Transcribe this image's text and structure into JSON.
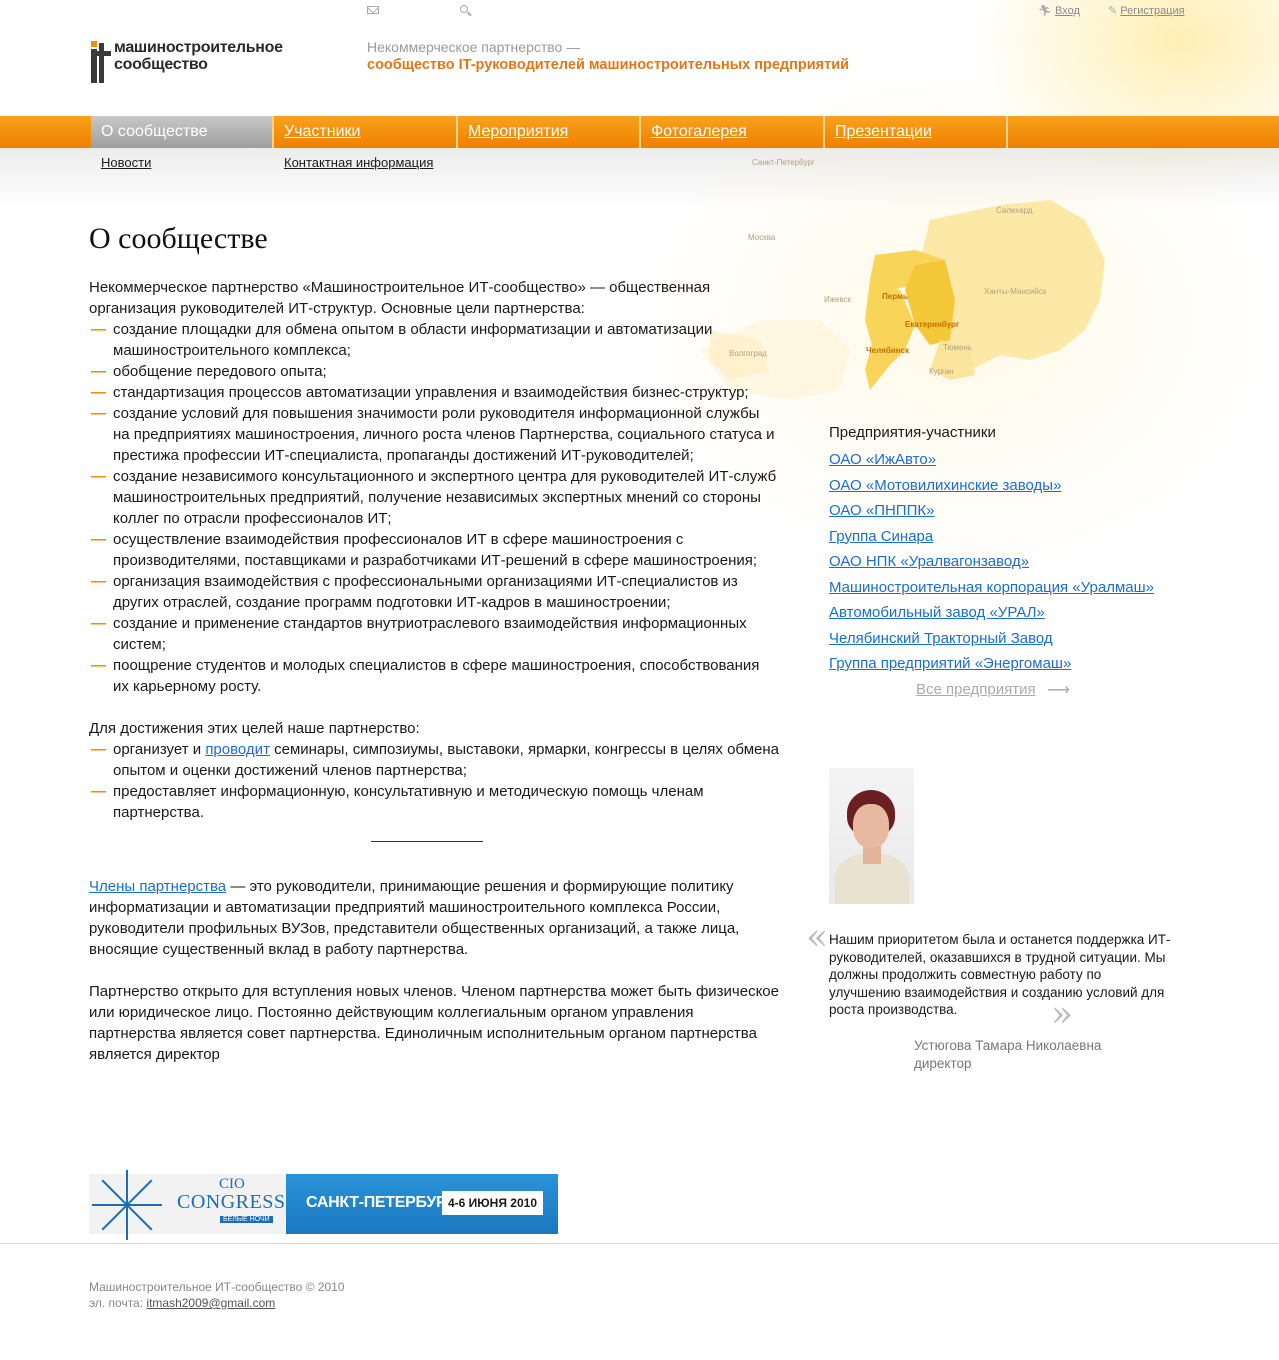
{
  "top": {
    "login_label": "Вход",
    "register_label": "Регистрация"
  },
  "logo": {
    "line1": "машиностроительное",
    "line2": "сообщество"
  },
  "tagline": {
    "line1": "Некоммерческое партнерство —",
    "line2": "сообщество IT-руководителей машиностроительных предприятий"
  },
  "nav": {
    "items": [
      {
        "label": "О сообществе",
        "active": true
      },
      {
        "label": "Участники"
      },
      {
        "label": "Мероприятия"
      },
      {
        "label": "Фотогалерея"
      },
      {
        "label": "Презентации"
      }
    ],
    "sub": [
      "Новости",
      "Контактная информация"
    ]
  },
  "map": {
    "labels": [
      "Санкт-Петербург",
      "Москва",
      "Салехард",
      "Ижевск",
      "Пермь",
      "Ханты-Мансийск",
      "Екатеринбург",
      "Волгоград",
      "Челябинск",
      "Тюмень",
      "Курган"
    ]
  },
  "main": {
    "title": "О сообществе",
    "intro": "Некоммерческое партнерство «Машиностроительное ИТ-сообщество» — общественная организация руководителей ИТ-структур. Основные цели партнерства:",
    "goals": [
      "создание площадки для обмена опытом в области информатизации и автоматизации машиностроительного комплекса;",
      "обобщение передового опыта;",
      "стандартизация процессов автоматизации управления и взаимодействия бизнес-структур;",
      "создание условий для повышения значимости роли руководителя информационной службы на предприятиях машиностроения, личного роста членов Партнерства, социального статуса и престижа профессии ИТ-специалиста, пропаганды достижений ИТ-руководителей;",
      "создание независимого консультационного и экспертного центра для руководителей ИТ-служб машиностроительных предприятий, получение независимых экспертных мнений со стороны коллег по отрасли профессионалов ИТ;",
      "осуществление взаимодействия профессионалов ИТ в сфере машиностроения с производителями, поставщиками и разработчиками ИТ-решений в сфере машиностроения;",
      "организация взаимодействия с профессиональными организациями ИТ-специалистов из других отраслей, создание программ подготовки ИТ-кадров в машиностроении;",
      "создание и применение стандартов внутриотраслевого взаимодействия информационных систем;",
      "поощрение студентов и молодых специалистов в сфере машиностроения, способствования их карьерному росту."
    ],
    "means_intro": "Для достижения этих целей наше партнерство:",
    "means1_pre": "организует и ",
    "means1_link": "проводит",
    "means1_post": " семинары, симпозиумы, выставоки, ярмарки, конгрессы в целях обмена опытом и оценки достижений членов партнерства;",
    "means2": "предоставляет информационную, консультативную и методическую помощь членам партнерства.",
    "members_link": "Члены партнерства",
    "members_text": " — это руководители, принимающие решения и формирующие политику информатизации и автоматизации предприятий машиностроительного комплекса России, руководители профильных ВУЗов, представители общественных организаций, а также лица, вносящие существенный вклад в работу партнерства.",
    "open_text": "Партнерство открыто для вступления новых членов. Членом партнерства может быть физическое или юридическое лицо. Постоянно действующим коллегиальным органом управления партнерства является совет партнерства. Единоличным исполнительным органом партнерства является директор"
  },
  "companies": {
    "header": "Предприятия-участники",
    "items": [
      "ОАО «ИжАвто»",
      "ОАО «Мотовилихинские заводы»",
      "ОАО «ПНППК»",
      "Группа Синара",
      "ОАО НПК «Уралвагонзавод»",
      "Машиностроительная корпорация «Уралмаш»",
      "Автомобильный завод «УРАЛ»",
      "Челябинский Тракторный Завод",
      "Группа предприятий «Энергомаш»"
    ],
    "all_label": "Все предприятия"
  },
  "quote": {
    "text": "Нашим приоритетом была и останется поддержка ИТ-руководителей, оказавшихся в трудной ситуации. Мы должны продолжить совместную работу по улучшению взаимодействия и созданию условий для роста производства.",
    "author": "Устюгова Тамара Николаевна",
    "role": "директор"
  },
  "banner": {
    "cio": "CIO",
    "congress": "CONGRESS",
    "nights": "БЕЛЫЕ НОЧИ",
    "city": "САНКТ-ПЕТЕРБУРГ",
    "date": "4-6 ИЮНЯ 2010"
  },
  "footer": {
    "copyright": "Машиностроительное ИТ-сообщество © 2010",
    "email_label": "эл. почта: ",
    "email": "itmash2009@gmail.com"
  },
  "colors": {
    "accent": "#f08a00",
    "nav_orange": "#f7941d",
    "link": "#1a6ecf"
  }
}
